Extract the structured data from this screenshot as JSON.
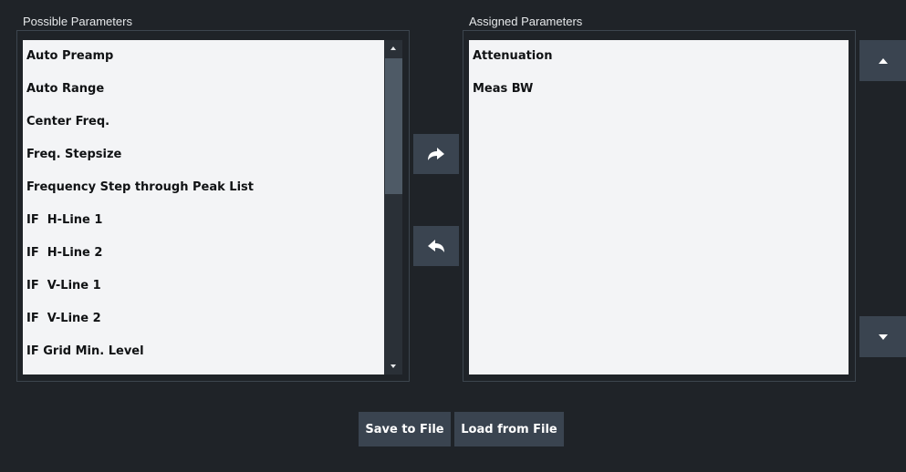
{
  "possible": {
    "title": "Possible Parameters",
    "items": [
      {
        "label": "Auto Preamp"
      },
      {
        "label": "Auto Range"
      },
      {
        "label": "Center Freq."
      },
      {
        "label": "Freq. Stepsize"
      },
      {
        "label": "Frequency Step through Peak List"
      },
      {
        "label": "IF  H-Line 1"
      },
      {
        "label": "IF  H-Line 2"
      },
      {
        "label": "IF  V-Line 1"
      },
      {
        "label": "IF  V-Line 2"
      },
      {
        "label": "IF Grid Min. Level"
      }
    ]
  },
  "assigned": {
    "title": "Assigned Parameters",
    "items": [
      {
        "label": "Attenuation"
      },
      {
        "label": "Meas BW"
      }
    ]
  },
  "buttons": {
    "save": "Save to File",
    "load": "Load from File"
  },
  "icons": {
    "add": "arrow-right-icon",
    "remove": "arrow-left-icon",
    "move_up": "chevron-up-icon",
    "move_down": "chevron-down-icon"
  },
  "colors": {
    "background": "#1f2328",
    "list_background": "#f3f4f6",
    "button_background": "#3a4450",
    "scroll_thumb": "#4e5a66"
  }
}
